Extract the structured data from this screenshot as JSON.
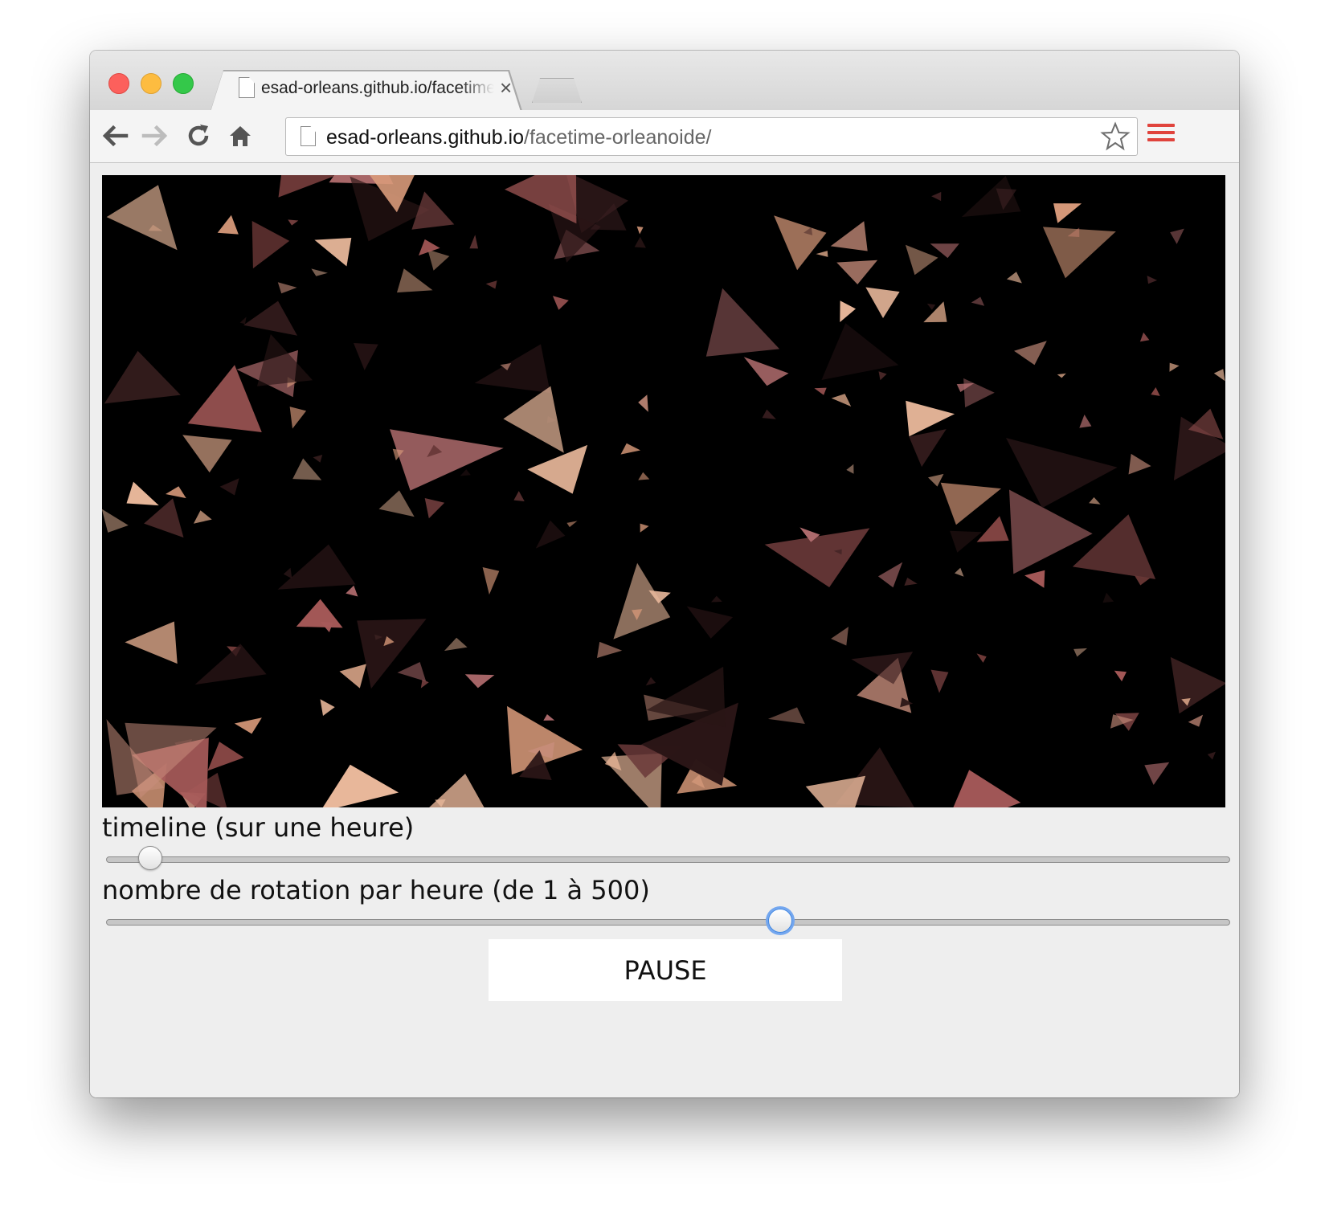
{
  "browser": {
    "tab": {
      "title": "esad-orleans.github.io/facetime-orleanoide/",
      "close_glyph": "×"
    },
    "nav_icons": [
      "back-arrow-icon",
      "forward-arrow-icon",
      "reload-icon",
      "home-icon"
    ],
    "address_bar": {
      "host": "esad-orleans.github.io",
      "path": "/facetime-orleanoide/"
    },
    "menu_color": "#e0433c"
  },
  "page": {
    "canvas_background": "#000000",
    "triangle_palette": [
      "#d89a7a",
      "#b26d6f",
      "#6b3a3a",
      "#3d2022",
      "#c98e7c",
      "#e8b79a",
      "#8e4a48",
      "#2a1516",
      "#d4a184",
      "#a75a59"
    ],
    "timeline": {
      "label": "timeline (sur une heure)",
      "value_fraction": 0.038
    },
    "rotation": {
      "label": "nombre de rotation par heure (de 1 à 500)",
      "value": 300,
      "min": 1,
      "max": 500
    },
    "pause_button": {
      "label": "PAUSE"
    }
  }
}
